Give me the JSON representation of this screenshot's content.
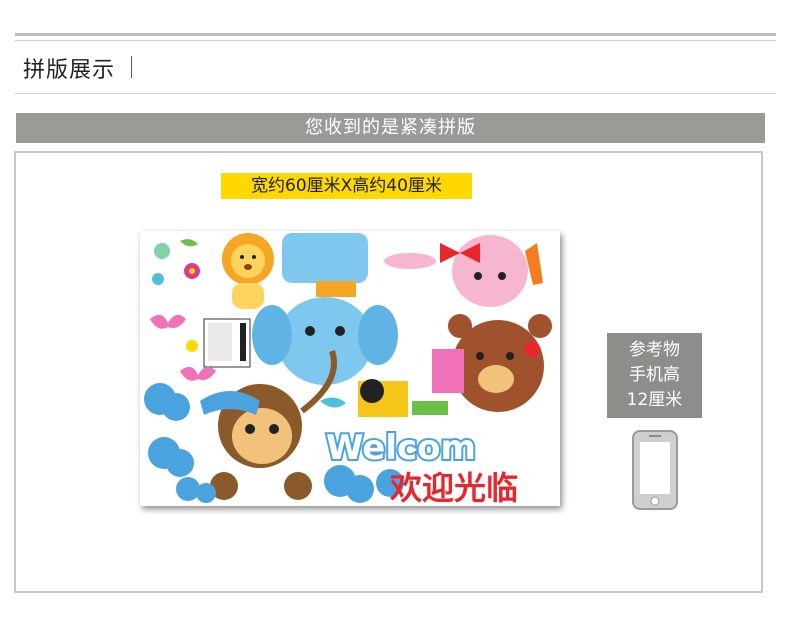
{
  "header": {
    "title": "拼版展示"
  },
  "banner": {
    "text": "您收到的是紧凑拼版"
  },
  "dimensions": {
    "label": "宽约60厘米X高约40厘米"
  },
  "reference": {
    "line1": "参考物",
    "line2": "手机高",
    "line3": "12厘米"
  },
  "sticker": {
    "welcome_text": "Welcom",
    "welcome_cn": "欢迎光临",
    "colors": {
      "lion": "#f5a623",
      "elephant": "#7ec8f0",
      "bunny": "#f7b6cf",
      "bear": "#a0522d",
      "monkey": "#8b5a2b",
      "cloud": "#4aa3df"
    }
  },
  "icons": {
    "phone": "phone-icon"
  }
}
